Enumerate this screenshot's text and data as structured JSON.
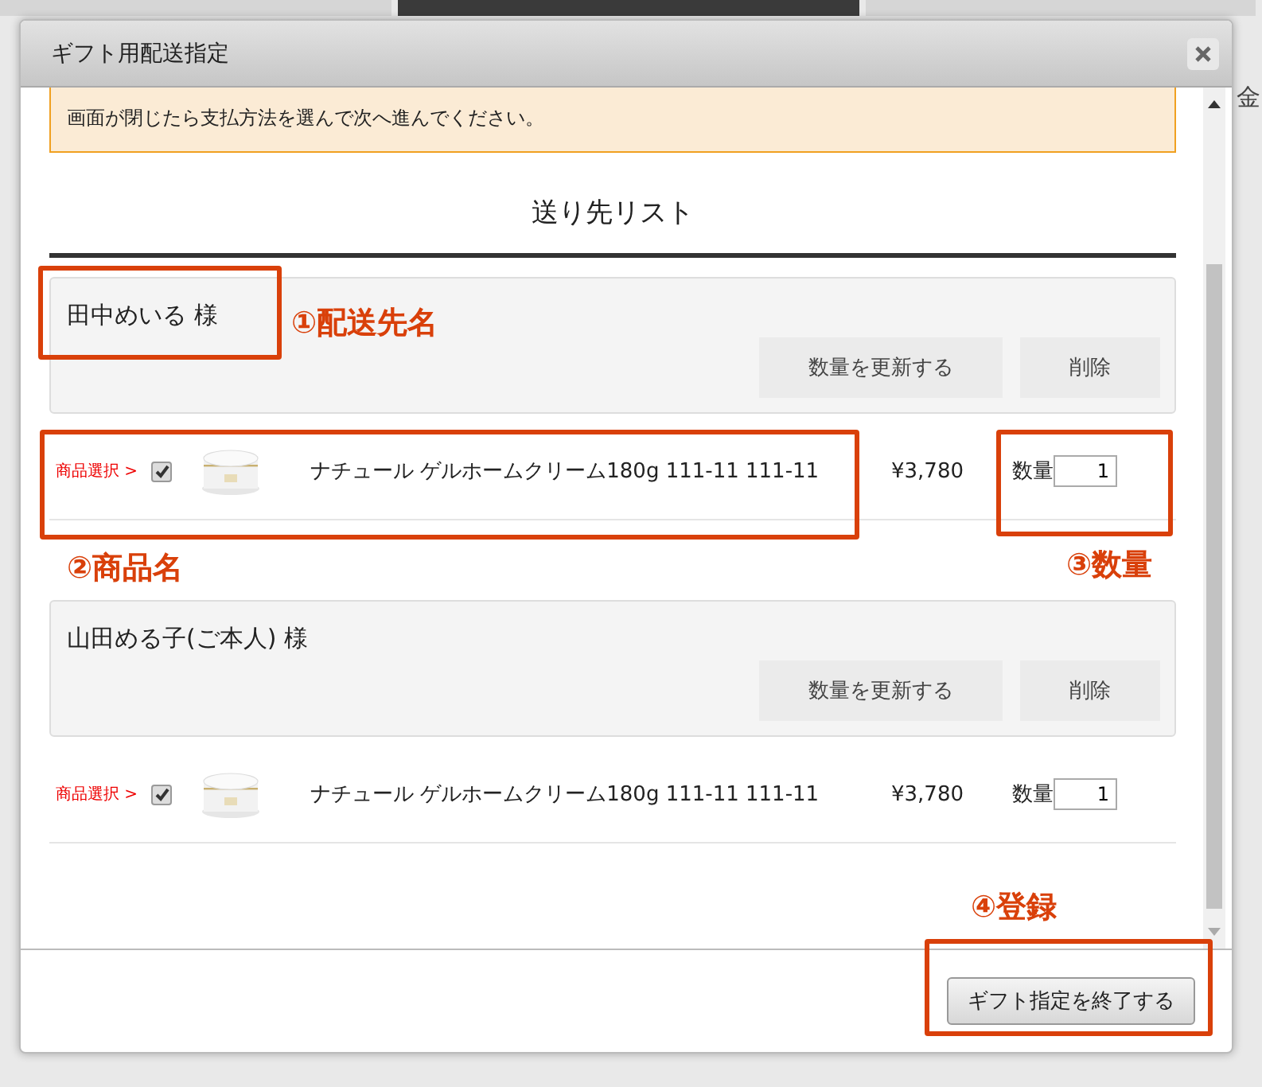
{
  "background": {
    "side_label": "金"
  },
  "window": {
    "title": "ギフト用配送指定"
  },
  "notice": "画面が閉じたら支払方法を選んで次へ進んでください。",
  "heading": "送り先リスト",
  "recipients": [
    {
      "name": "田中めいる 様",
      "buttons": [
        "数量を更新する",
        "削除"
      ],
      "items": [
        {
          "select_label": "商品選択 >",
          "checked": true,
          "product": "ナチュール ゲルホームクリーム180g 111-11 111-11",
          "price": "¥3,780",
          "qty_label": "数量",
          "qty": "1"
        }
      ]
    },
    {
      "name": "山田める子(ご本人) 様",
      "buttons": [
        "数量を更新する",
        "削除"
      ],
      "items": [
        {
          "select_label": "商品選択 >",
          "checked": true,
          "product": "ナチュール ゲルホームクリーム180g 111-11 111-11",
          "price": "¥3,780",
          "qty_label": "数量",
          "qty": "1"
        }
      ]
    }
  ],
  "footer_button": "ギフト指定を終了する",
  "annotations": [
    {
      "number": "①",
      "label": "配送先名"
    },
    {
      "number": "②",
      "label": "商品名"
    },
    {
      "number": "③",
      "label": "数量"
    },
    {
      "number": "④",
      "label": "登録"
    }
  ]
}
